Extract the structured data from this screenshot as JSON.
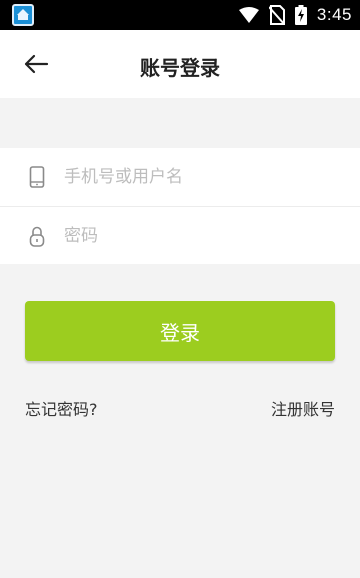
{
  "status_bar": {
    "time": "3:45",
    "icons": [
      "app-notification-icon",
      "wifi-icon",
      "no-sim-icon",
      "battery-charging-icon"
    ]
  },
  "header": {
    "back_icon": "arrow-left-icon",
    "title": "账号登录"
  },
  "form": {
    "username": {
      "icon": "phone-icon",
      "placeholder": "手机号或用户名",
      "value": ""
    },
    "password": {
      "icon": "lock-icon",
      "placeholder": "密码",
      "value": ""
    }
  },
  "login_button": {
    "label": "登录"
  },
  "links": {
    "forgot_password": "忘记密码?",
    "register": "注册账号"
  },
  "colors": {
    "accent": "#9ccd1f",
    "background": "#f3f3f3",
    "status_bar": "#000000"
  }
}
